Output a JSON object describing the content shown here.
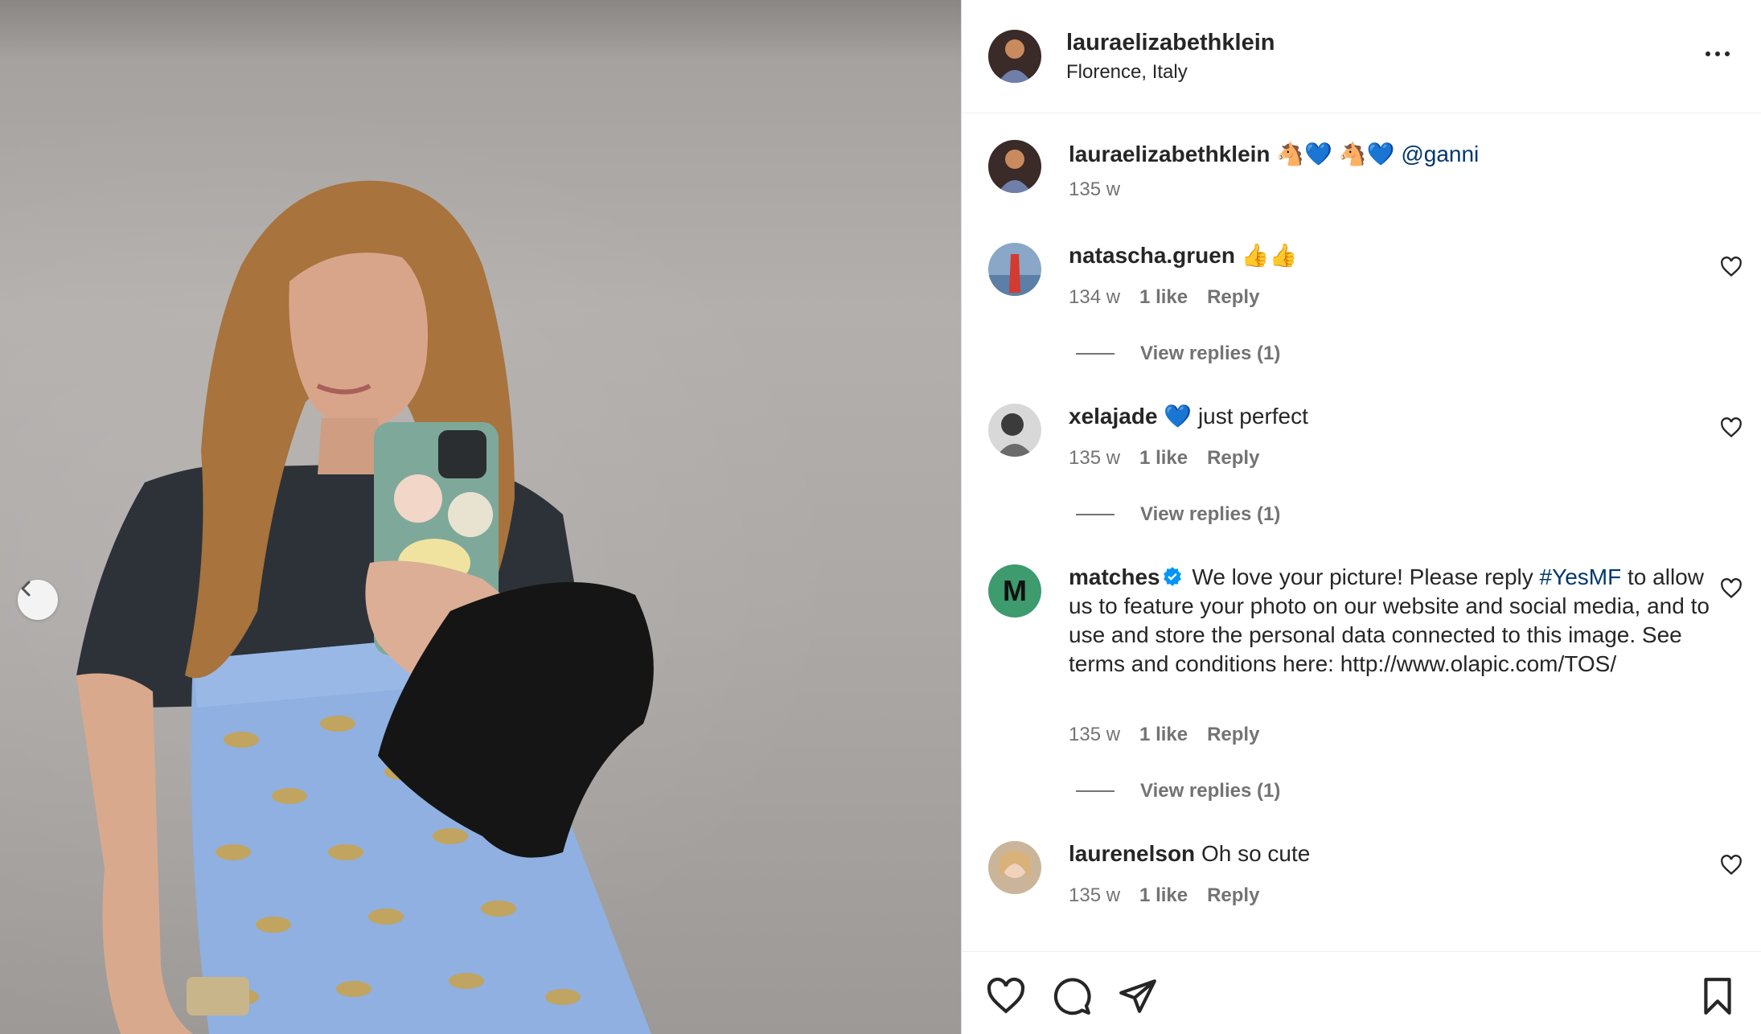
{
  "post": {
    "username": "lauraelizabethklein",
    "location": "Florence, Italy"
  },
  "caption": {
    "username": "lauraelizabethklein",
    "emojis": "🐴💙 🐴💙",
    "mention": "@ganni",
    "time": "135 w"
  },
  "comments": [
    {
      "username": "natascha.gruen",
      "text": "👍👍",
      "time": "134 w",
      "likes": "1 like",
      "reply": "Reply",
      "view_replies": "View replies (1)"
    },
    {
      "username": "xelajade",
      "text": "💙 just perfect",
      "time": "135 w",
      "likes": "1 like",
      "reply": "Reply",
      "view_replies": "View replies (1)"
    },
    {
      "username": "matches",
      "text_before": "We love your picture! Please reply",
      "hashtag": "#YesMF",
      "text_after": "to allow us to feature your photo on our website and social media, and to use and store the personal data connected to this image. See terms and conditions here: http://www.olapic.com/TOS/",
      "avatar_letter": "M",
      "time": "135 w",
      "likes": "1 like",
      "reply": "Reply",
      "view_replies": "View replies (1)"
    },
    {
      "username": "laurenelson",
      "text": "Oh so cute",
      "time": "135 w",
      "likes": "1 like",
      "reply": "Reply"
    }
  ],
  "icons": {
    "more": "more-options-icon",
    "like": "heart-icon",
    "comment": "comment-icon",
    "share": "share-icon",
    "save": "bookmark-icon",
    "prev": "chevron-left-icon",
    "verified": "verified-badge-icon"
  },
  "colors": {
    "link": "#00376b",
    "meta": "#737373",
    "text": "#262626",
    "matches_avatar": "#3d9b6e",
    "verified": "#0095f6"
  }
}
